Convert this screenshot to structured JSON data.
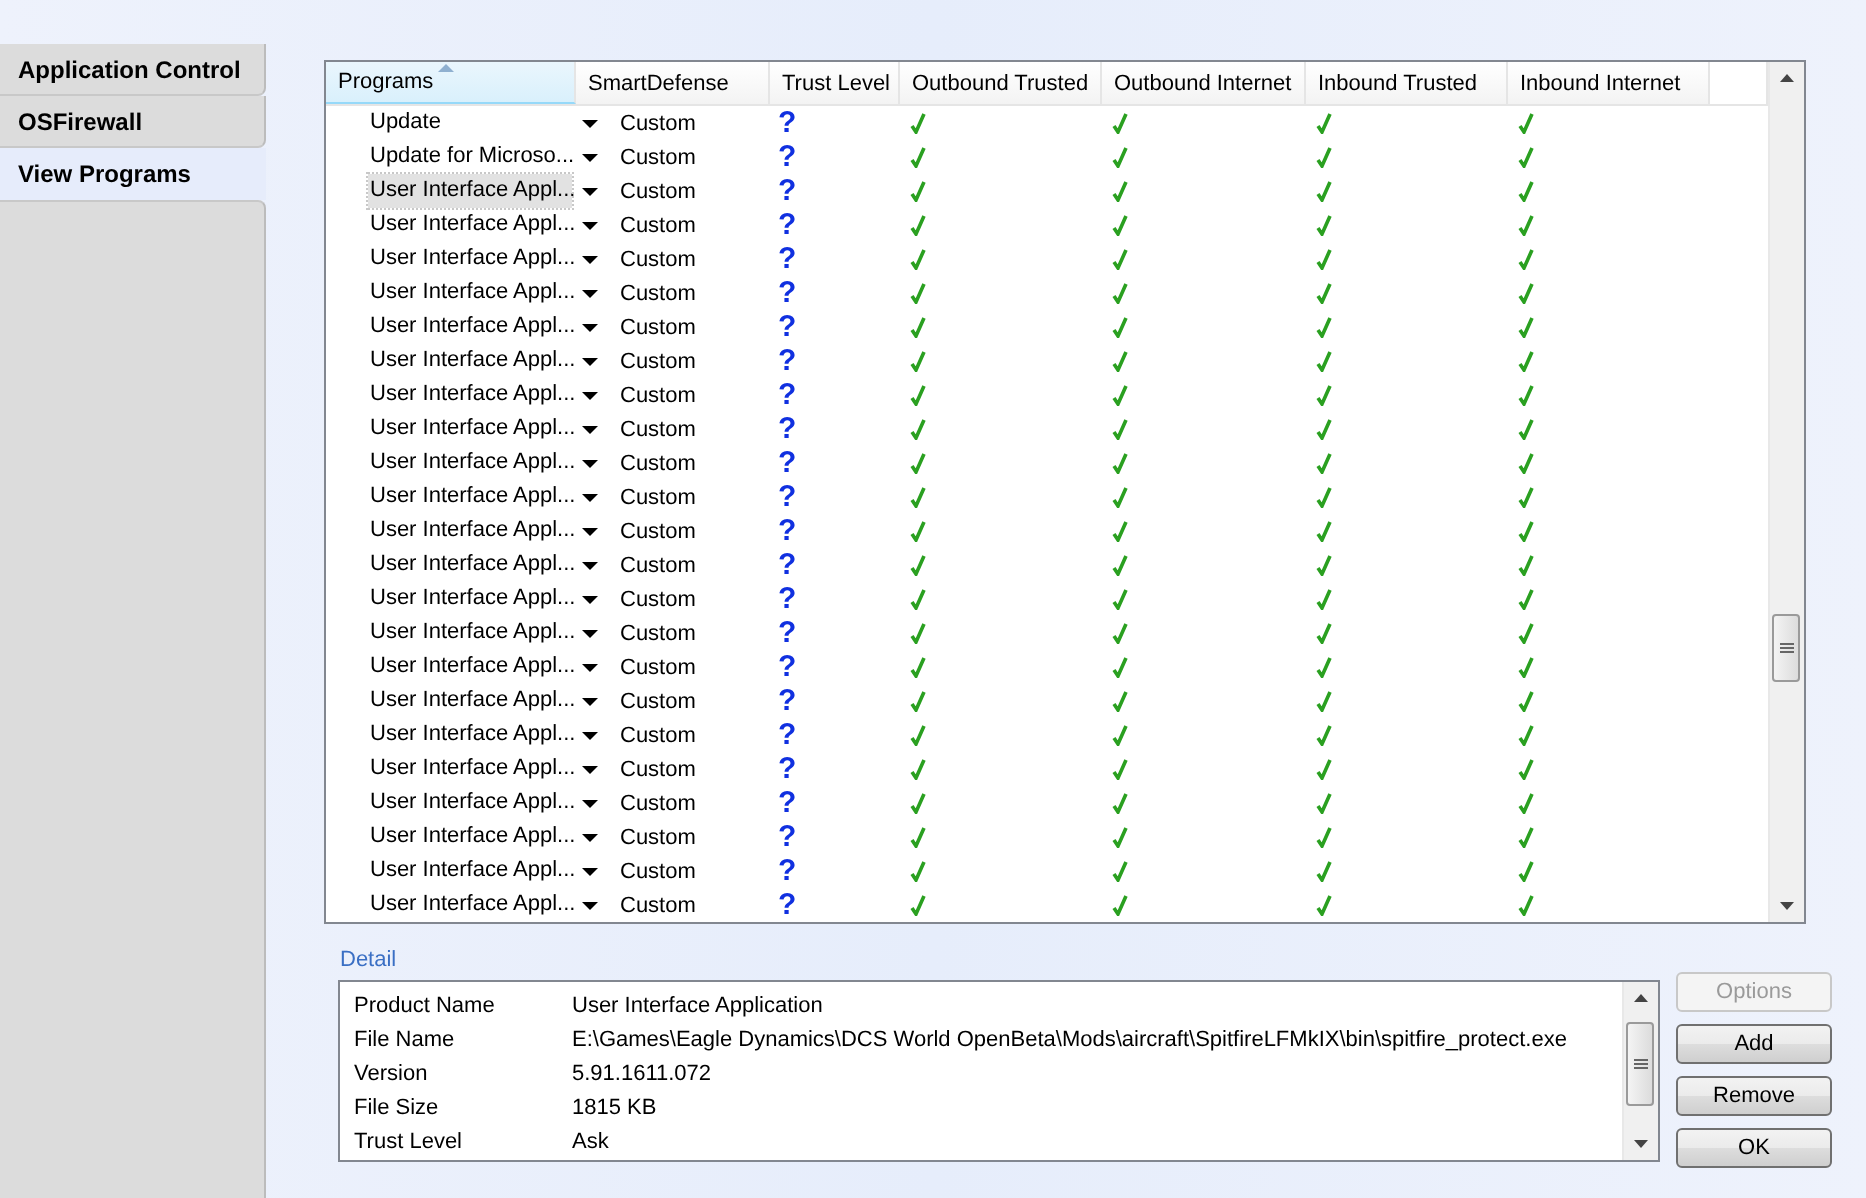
{
  "sidebar": {
    "tabs": [
      {
        "label": "Application Control",
        "selected": false
      },
      {
        "label": "OSFirewall",
        "selected": false
      },
      {
        "label": "View Programs",
        "selected": true
      }
    ]
  },
  "table": {
    "columns": [
      "Programs",
      "SmartDefense",
      "Trust Level",
      "Outbound Trusted",
      "Outbound Internet",
      "Inbound Trusted",
      "Inbound Internet"
    ],
    "rows": [
      {
        "program": "Update",
        "smart_defense": "Custom",
        "trust": "?",
        "selected": false,
        "outbound_trusted": true,
        "outbound_internet": true,
        "inbound_trusted": true,
        "inbound_internet": true
      },
      {
        "program": "Update for Microso...",
        "smart_defense": "Custom",
        "trust": "?",
        "selected": false,
        "outbound_trusted": true,
        "outbound_internet": true,
        "inbound_trusted": true,
        "inbound_internet": true
      },
      {
        "program": "User Interface Appl...",
        "smart_defense": "Custom",
        "trust": "?",
        "selected": true,
        "outbound_trusted": true,
        "outbound_internet": true,
        "inbound_trusted": true,
        "inbound_internet": true
      },
      {
        "program": "User Interface Appl...",
        "smart_defense": "Custom",
        "trust": "?",
        "selected": false,
        "outbound_trusted": true,
        "outbound_internet": true,
        "inbound_trusted": true,
        "inbound_internet": true
      },
      {
        "program": "User Interface Appl...",
        "smart_defense": "Custom",
        "trust": "?",
        "selected": false,
        "outbound_trusted": true,
        "outbound_internet": true,
        "inbound_trusted": true,
        "inbound_internet": true
      },
      {
        "program": "User Interface Appl...",
        "smart_defense": "Custom",
        "trust": "?",
        "selected": false,
        "outbound_trusted": true,
        "outbound_internet": true,
        "inbound_trusted": true,
        "inbound_internet": true
      },
      {
        "program": "User Interface Appl...",
        "smart_defense": "Custom",
        "trust": "?",
        "selected": false,
        "outbound_trusted": true,
        "outbound_internet": true,
        "inbound_trusted": true,
        "inbound_internet": true
      },
      {
        "program": "User Interface Appl...",
        "smart_defense": "Custom",
        "trust": "?",
        "selected": false,
        "outbound_trusted": true,
        "outbound_internet": true,
        "inbound_trusted": true,
        "inbound_internet": true
      },
      {
        "program": "User Interface Appl...",
        "smart_defense": "Custom",
        "trust": "?",
        "selected": false,
        "outbound_trusted": true,
        "outbound_internet": true,
        "inbound_trusted": true,
        "inbound_internet": true
      },
      {
        "program": "User Interface Appl...",
        "smart_defense": "Custom",
        "trust": "?",
        "selected": false,
        "outbound_trusted": true,
        "outbound_internet": true,
        "inbound_trusted": true,
        "inbound_internet": true
      },
      {
        "program": "User Interface Appl...",
        "smart_defense": "Custom",
        "trust": "?",
        "selected": false,
        "outbound_trusted": true,
        "outbound_internet": true,
        "inbound_trusted": true,
        "inbound_internet": true
      },
      {
        "program": "User Interface Appl...",
        "smart_defense": "Custom",
        "trust": "?",
        "selected": false,
        "outbound_trusted": true,
        "outbound_internet": true,
        "inbound_trusted": true,
        "inbound_internet": true
      },
      {
        "program": "User Interface Appl...",
        "smart_defense": "Custom",
        "trust": "?",
        "selected": false,
        "outbound_trusted": true,
        "outbound_internet": true,
        "inbound_trusted": true,
        "inbound_internet": true
      },
      {
        "program": "User Interface Appl...",
        "smart_defense": "Custom",
        "trust": "?",
        "selected": false,
        "outbound_trusted": true,
        "outbound_internet": true,
        "inbound_trusted": true,
        "inbound_internet": true
      },
      {
        "program": "User Interface Appl...",
        "smart_defense": "Custom",
        "trust": "?",
        "selected": false,
        "outbound_trusted": true,
        "outbound_internet": true,
        "inbound_trusted": true,
        "inbound_internet": true
      },
      {
        "program": "User Interface Appl...",
        "smart_defense": "Custom",
        "trust": "?",
        "selected": false,
        "outbound_trusted": true,
        "outbound_internet": true,
        "inbound_trusted": true,
        "inbound_internet": true
      },
      {
        "program": "User Interface Appl...",
        "smart_defense": "Custom",
        "trust": "?",
        "selected": false,
        "outbound_trusted": true,
        "outbound_internet": true,
        "inbound_trusted": true,
        "inbound_internet": true
      },
      {
        "program": "User Interface Appl...",
        "smart_defense": "Custom",
        "trust": "?",
        "selected": false,
        "outbound_trusted": true,
        "outbound_internet": true,
        "inbound_trusted": true,
        "inbound_internet": true
      },
      {
        "program": "User Interface Appl...",
        "smart_defense": "Custom",
        "trust": "?",
        "selected": false,
        "outbound_trusted": true,
        "outbound_internet": true,
        "inbound_trusted": true,
        "inbound_internet": true
      },
      {
        "program": "User Interface Appl...",
        "smart_defense": "Custom",
        "trust": "?",
        "selected": false,
        "outbound_trusted": true,
        "outbound_internet": true,
        "inbound_trusted": true,
        "inbound_internet": true
      },
      {
        "program": "User Interface Appl...",
        "smart_defense": "Custom",
        "trust": "?",
        "selected": false,
        "outbound_trusted": true,
        "outbound_internet": true,
        "inbound_trusted": true,
        "inbound_internet": true
      },
      {
        "program": "User Interface Appl...",
        "smart_defense": "Custom",
        "trust": "?",
        "selected": false,
        "outbound_trusted": true,
        "outbound_internet": true,
        "inbound_trusted": true,
        "inbound_internet": true
      },
      {
        "program": "User Interface Appl...",
        "smart_defense": "Custom",
        "trust": "?",
        "selected": false,
        "outbound_trusted": true,
        "outbound_internet": true,
        "inbound_trusted": true,
        "inbound_internet": true
      },
      {
        "program": "User Interface Appl...",
        "smart_defense": "Custom",
        "trust": "?",
        "selected": false,
        "outbound_trusted": true,
        "outbound_internet": true,
        "inbound_trusted": true,
        "inbound_internet": true
      }
    ]
  },
  "detail": {
    "title": "Detail",
    "fields": [
      {
        "label": "Product Name",
        "value": "User Interface Application"
      },
      {
        "label": "File Name",
        "value": "E:\\Games\\Eagle Dynamics\\DCS World OpenBeta\\Mods\\aircraft\\SpitfireLFMkIX\\bin\\spitfire_protect.exe"
      },
      {
        "label": "Version",
        "value": "5.91.1611.072"
      },
      {
        "label": "File Size",
        "value": "1815 KB"
      },
      {
        "label": "Trust Level",
        "value": "Ask"
      }
    ]
  },
  "buttons": [
    {
      "label": "Options",
      "disabled": true
    },
    {
      "label": "Add",
      "disabled": false
    },
    {
      "label": "Remove",
      "disabled": false
    },
    {
      "label": "OK",
      "disabled": false
    }
  ]
}
